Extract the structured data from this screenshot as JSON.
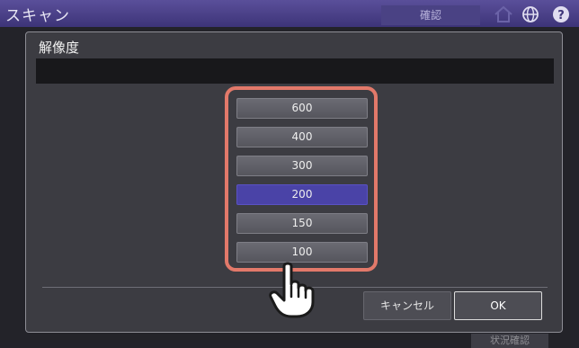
{
  "app": {
    "title": "スキャン",
    "confirm_tab": "確認",
    "status_tab": "状況確認"
  },
  "dialog": {
    "title": "解像度",
    "options": [
      {
        "label": "600",
        "selected": false
      },
      {
        "label": "400",
        "selected": false
      },
      {
        "label": "300",
        "selected": false
      },
      {
        "label": "200",
        "selected": true
      },
      {
        "label": "150",
        "selected": false
      },
      {
        "label": "100",
        "selected": false
      }
    ],
    "cancel_label": "キャンセル",
    "ok_label": "OK"
  },
  "colors": {
    "highlight_border": "#e2796a",
    "selected": "#4a43a7",
    "header": "#5a4f9a"
  },
  "icons": [
    "home-icon",
    "globe-icon",
    "help-icon",
    "hand-cursor-icon"
  ]
}
